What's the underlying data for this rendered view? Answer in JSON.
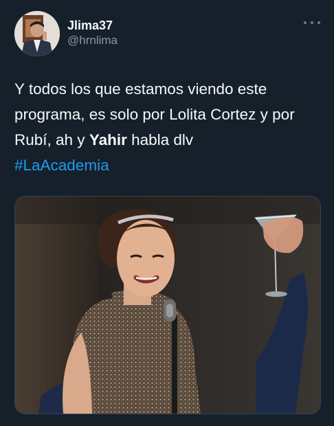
{
  "user": {
    "display_name": "Jlima37",
    "handle": "@hrnlima"
  },
  "tweet": {
    "segment_1": "Y todos los que estamos viendo este programa, es solo por Lolita Cortez y por Rubí, ah y ",
    "bold": "Yahir",
    "segment_2": " habla dlv",
    "hashtag": "#LaAcademia"
  },
  "icons": {
    "more": "more-horizontal-icon"
  },
  "colors": {
    "background": "#15202b",
    "text": "#f7f9f9",
    "secondary_text": "#8b98a5",
    "link": "#1d9bf0"
  }
}
